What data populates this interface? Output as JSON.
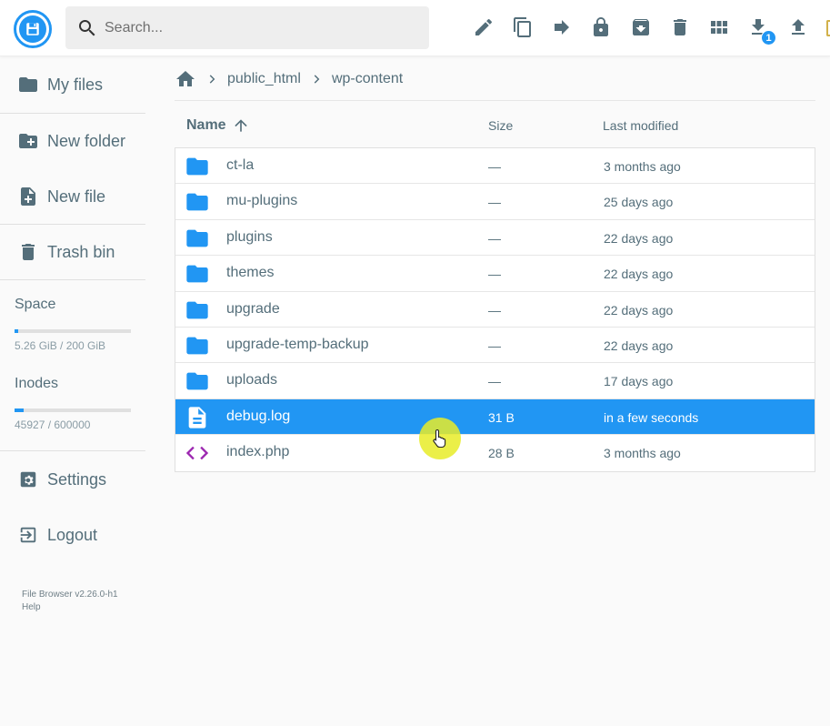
{
  "app": {
    "name": "File Browser"
  },
  "search": {
    "placeholder": "Search..."
  },
  "toolbar": {
    "buttons": [
      {
        "name": "edit-icon"
      },
      {
        "name": "copy-icon"
      },
      {
        "name": "move-icon"
      },
      {
        "name": "lock-icon"
      },
      {
        "name": "archive-icon"
      },
      {
        "name": "delete-icon"
      },
      {
        "name": "grid-view-icon"
      },
      {
        "name": "download-icon"
      },
      {
        "name": "upload-icon"
      }
    ],
    "download_badge": "1"
  },
  "sidebar": {
    "items": [
      {
        "label": "My files",
        "icon": "folder-icon"
      },
      {
        "label": "New folder",
        "icon": "create-new-folder-icon"
      },
      {
        "label": "New file",
        "icon": "note-add-icon"
      },
      {
        "label": "Trash bin",
        "icon": "trash-icon"
      },
      {
        "label": "Settings",
        "icon": "settings-icon"
      },
      {
        "label": "Logout",
        "icon": "logout-icon"
      }
    ],
    "space": {
      "title": "Space",
      "text": "5.26 GiB / 200 GiB",
      "fraction": 0.026
    },
    "inodes": {
      "title": "Inodes",
      "text": "45927 / 600000",
      "fraction": 0.077
    },
    "credits": {
      "version": "File Browser v2.26.0-h1",
      "help": "Help"
    }
  },
  "breadcrumb": [
    "public_html",
    "wp-content"
  ],
  "listing": {
    "headers": {
      "name": "Name",
      "size": "Size",
      "modified": "Last modified"
    },
    "rows": [
      {
        "name": "ct-la",
        "size": "—",
        "modified": "3 months ago",
        "type": "folder"
      },
      {
        "name": "mu-plugins",
        "size": "—",
        "modified": "25 days ago",
        "type": "folder"
      },
      {
        "name": "plugins",
        "size": "—",
        "modified": "22 days ago",
        "type": "folder"
      },
      {
        "name": "themes",
        "size": "—",
        "modified": "22 days ago",
        "type": "folder"
      },
      {
        "name": "upgrade",
        "size": "—",
        "modified": "22 days ago",
        "type": "folder"
      },
      {
        "name": "upgrade-temp-backup",
        "size": "—",
        "modified": "22 days ago",
        "type": "folder"
      },
      {
        "name": "uploads",
        "size": "—",
        "modified": "17 days ago",
        "type": "folder"
      },
      {
        "name": "debug.log",
        "size": "31 B",
        "modified": "in a few seconds",
        "type": "text",
        "selected": true
      },
      {
        "name": "index.php",
        "size": "28 B",
        "modified": "3 months ago",
        "type": "code"
      }
    ]
  },
  "colors": {
    "accent": "#2196f3",
    "text": "#546e7a",
    "code": "#9c27b0"
  }
}
